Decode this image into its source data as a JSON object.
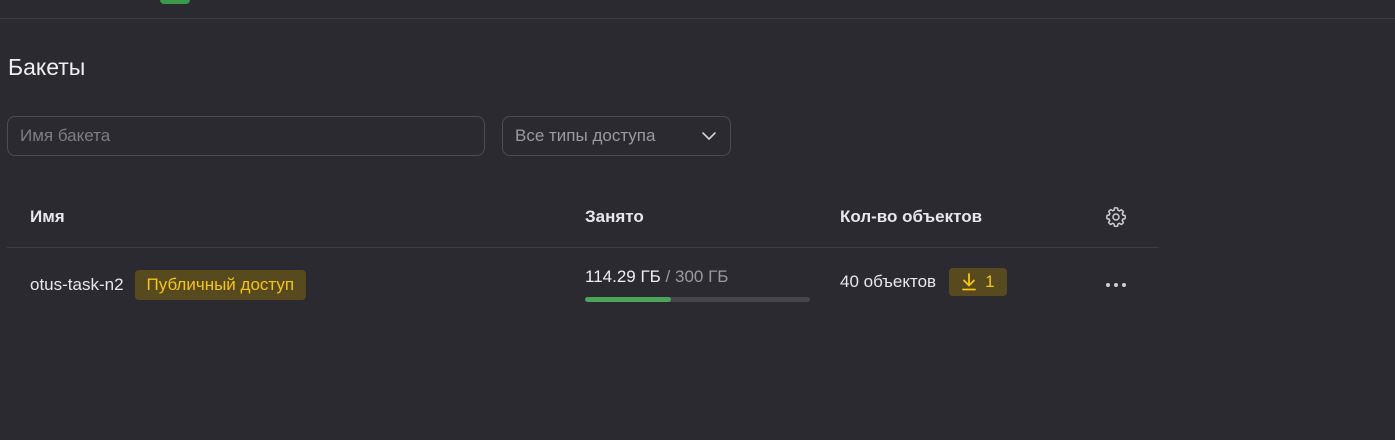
{
  "page": {
    "title": "Бакеты"
  },
  "filters": {
    "search_placeholder": "Имя бакета",
    "search_value": "",
    "access_select_value": "Все типы доступа"
  },
  "table": {
    "columns": {
      "name": "Имя",
      "size": "Занято",
      "objects": "Кол-во объектов"
    },
    "rows": [
      {
        "name": "otus-task-n2",
        "access_badge": "Публичный доступ",
        "size_used": "114.29 ГБ",
        "size_separator": " / ",
        "size_total": "300 ГБ",
        "usage_fraction": 0.381,
        "objects": "40 объектов",
        "downloads_count": "1"
      }
    ]
  },
  "colors": {
    "background": "#2b2a30",
    "badge_bg": "#574a1f",
    "badge_text": "#f5c518",
    "progress": "#4ca35a"
  },
  "icons": [
    "chevron-down-icon",
    "gear-icon",
    "download-icon",
    "more-icon"
  ]
}
